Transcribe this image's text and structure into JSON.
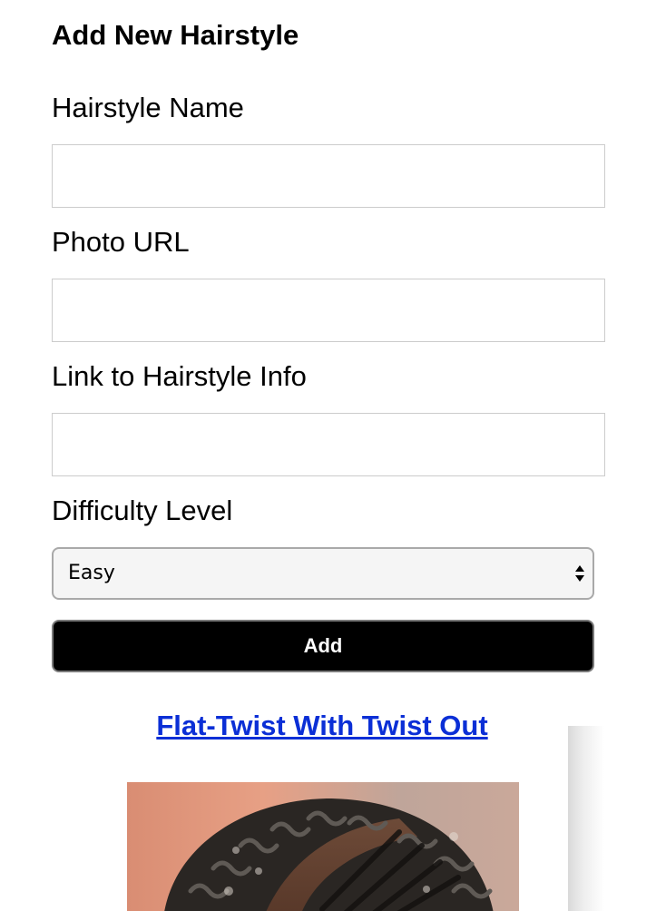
{
  "form": {
    "title": "Add New Hairstyle",
    "fields": {
      "name": {
        "label": "Hairstyle Name",
        "value": ""
      },
      "photo_url": {
        "label": "Photo URL",
        "value": ""
      },
      "info_link": {
        "label": "Link to Hairstyle Info",
        "value": ""
      },
      "difficulty": {
        "label": "Difficulty Level",
        "selected": "Easy"
      }
    },
    "submit_label": "Add"
  },
  "hairstyles": [
    {
      "title": "Flat-Twist With Twist Out",
      "photo": "hairstyle-photo"
    }
  ],
  "colors": {
    "link": "#0b2fd6",
    "button_bg": "#000000",
    "button_text": "#ffffff",
    "input_border": "#cccccc"
  }
}
